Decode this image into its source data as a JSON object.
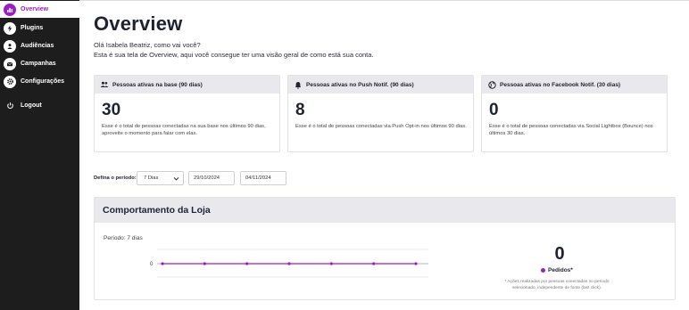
{
  "sidebar": {
    "items": [
      {
        "label": "Overview",
        "icon": "bar-chart-icon",
        "active": true
      },
      {
        "label": "Plugins",
        "icon": "lightning-icon"
      },
      {
        "label": "Audiências",
        "icon": "audience-icon"
      },
      {
        "label": "Campanhas",
        "icon": "envelope-icon"
      },
      {
        "label": "Configurações",
        "icon": "gear-icon"
      },
      {
        "label": "Logout",
        "icon": "power-icon"
      }
    ]
  },
  "header": {
    "title": "Overview",
    "greeting_line1": "Olá Isabela Beatriz, como vai você?",
    "greeting_line2": "Esta é sua tela de Overview, aqui você consegue ter uma visão geral de como está sua conta."
  },
  "cards": [
    {
      "title": "Pessoas ativas na base (90 dias)",
      "icon": "people-icon",
      "value": "30",
      "description": "Esse é o total de pessoas conectadas na sua base nos últimos 90 dias, aproveite o momento para falar com elas."
    },
    {
      "title": "Pessoas ativas no Push Notif. (90 dias)",
      "icon": "bell-icon",
      "value": "8",
      "description": "Esse é o total de pessoas conectadas via Push Opt-in nos últimos 90 dias."
    },
    {
      "title": "Pessoas ativas no Facebook Notif. (30 dias)",
      "icon": "globe-icon",
      "value": "0",
      "description": "Esse é o total de pessoas conectadas via Social Lightbox (Bounce) nos últimos 30 dias."
    }
  ],
  "filters": {
    "period_label": "Defina o período:",
    "period_selected": "7 Dias",
    "date_start": "29/10/2024",
    "date_end": "04/11/2024"
  },
  "store": {
    "title": "Comportamento da Loja",
    "period_text": "Período: 7 dias",
    "total_orders": "0",
    "orders_label": "Pedidos*",
    "footnote": "* Ações realizadas por pessoas conectadas no período selecionado, independente de fonte (last click)."
  },
  "chart_data": {
    "type": "line",
    "series": [
      {
        "name": "Pedidos",
        "values": [
          0,
          0,
          0,
          0,
          0,
          0,
          0
        ],
        "color": "#9c1ec2"
      }
    ],
    "y_tick_labels": [
      "0"
    ],
    "grid": true,
    "legend": "none"
  },
  "colors": {
    "accent": "#9c1ec2",
    "sidebar_bg": "#1d1d1d",
    "panel_header_bg": "#e9e9ed"
  }
}
